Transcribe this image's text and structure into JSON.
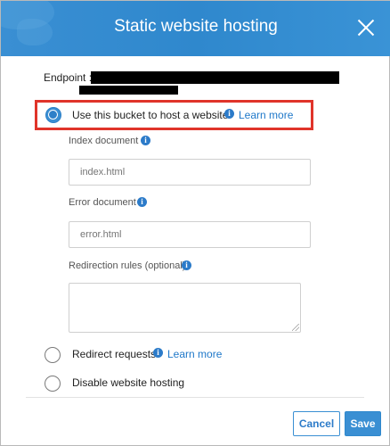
{
  "dialog": {
    "title": "Static website hosting",
    "endpoint_label": "Endpoint :"
  },
  "options": {
    "use_bucket": {
      "label": "Use this bucket to host a website",
      "learn_more": "Learn more",
      "selected": true
    },
    "redirect": {
      "label": "Redirect requests",
      "learn_more": "Learn more",
      "selected": false
    },
    "disable": {
      "label": "Disable website hosting",
      "selected": false
    }
  },
  "fields": {
    "index_document": {
      "label": "Index document",
      "placeholder": "index.html"
    },
    "error_document": {
      "label": "Error document",
      "placeholder": "error.html"
    },
    "redirection_rules": {
      "label": "Redirection rules (optional)"
    }
  },
  "footer": {
    "cancel_label": "Cancel",
    "save_label": "Save"
  },
  "icons": {
    "info": "info-icon",
    "close": "close-icon"
  },
  "colors": {
    "header": "#3a8fd3",
    "link": "#1f78c9",
    "highlight": "#e0342a"
  }
}
